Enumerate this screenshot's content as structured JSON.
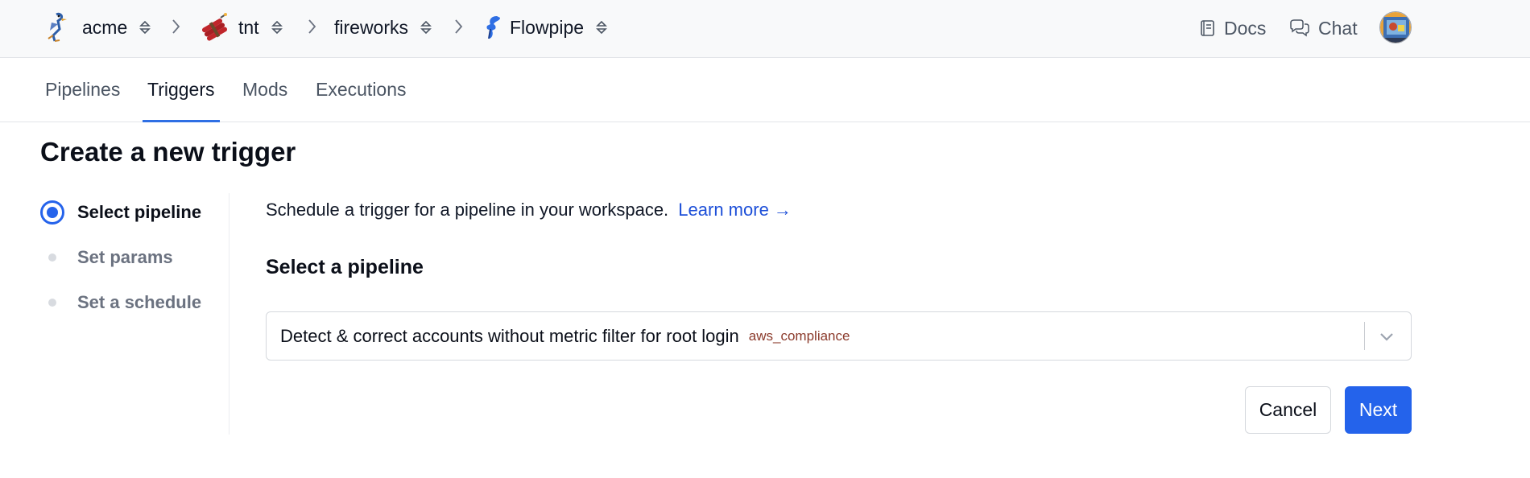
{
  "breadcrumb": {
    "items": [
      {
        "label": "acme",
        "icon": "roadrunner-logo-icon"
      },
      {
        "label": "tnt",
        "icon": "dynamite-logo-icon"
      },
      {
        "label": "fireworks",
        "icon": ""
      },
      {
        "label": "Flowpipe",
        "icon": "flowpipe-logo-icon"
      }
    ]
  },
  "header": {
    "docs_label": "Docs",
    "chat_label": "Chat"
  },
  "tabs": [
    {
      "label": "Pipelines",
      "active": false
    },
    {
      "label": "Triggers",
      "active": true
    },
    {
      "label": "Mods",
      "active": false
    },
    {
      "label": "Executions",
      "active": false
    }
  ],
  "page": {
    "title": "Create a new trigger"
  },
  "steps": [
    {
      "label": "Select pipeline",
      "active": true
    },
    {
      "label": "Set params",
      "active": false
    },
    {
      "label": "Set a schedule",
      "active": false
    }
  ],
  "form": {
    "intro_text": "Schedule a trigger for a pipeline in your workspace.",
    "learn_more_label": "Learn more →",
    "section_title": "Select a pipeline",
    "pipeline_select": {
      "value": "Detect & correct accounts without metric filter for root login",
      "mod": "aws_compliance"
    },
    "cancel_label": "Cancel",
    "next_label": "Next"
  },
  "colors": {
    "accent": "#2463eb",
    "link": "#1d4fd8",
    "mod_tag": "#8b3a2b"
  }
}
